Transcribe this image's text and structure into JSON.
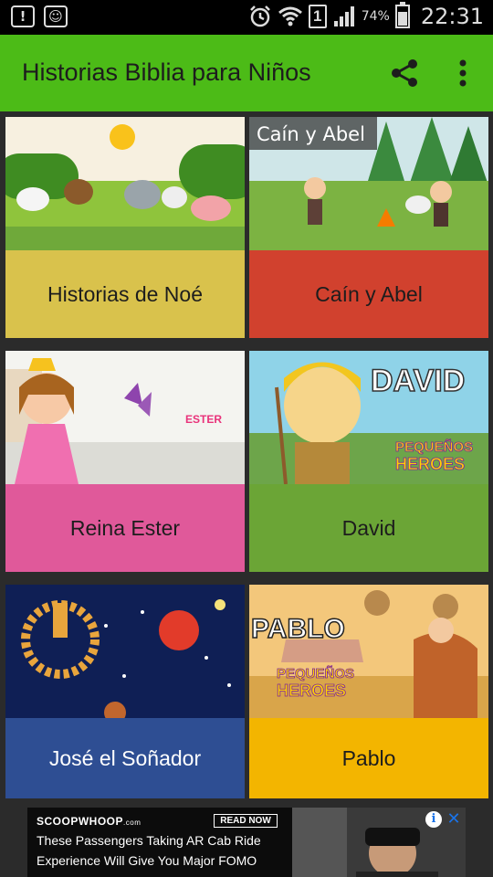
{
  "status_bar": {
    "battery_pct": "74%",
    "sim_label": "1",
    "time": "22:31",
    "icons": [
      "notification-alert-icon",
      "notification-face-icon",
      "alarm-icon",
      "wifi-icon",
      "sim-icon",
      "signal-icon",
      "battery-icon"
    ]
  },
  "app_bar": {
    "title": "Historias Biblia para Niños",
    "color": "#4cbb17",
    "actions": [
      "share-icon",
      "more-vert-icon"
    ]
  },
  "stories": [
    {
      "label": "Historias de Noé",
      "color": "#d9c24c",
      "thumb_caption": ""
    },
    {
      "label": "Caín y Abel",
      "color": "#d1412e",
      "thumb_caption": "Caín y Abel"
    },
    {
      "label": "Reina Ester",
      "color": "#e0599a",
      "thumb_caption": "ESTER"
    },
    {
      "label": "David",
      "color": "#6ba536",
      "thumb_caption": "DAVID",
      "thumb_caption2": "PEQUEÑOS",
      "thumb_caption3": "HEROES"
    },
    {
      "label": "José el Soñador",
      "color": "#2e4e93",
      "thumb_caption": ""
    },
    {
      "label": "Pablo",
      "color": "#f3b500",
      "thumb_caption": "PABLO",
      "thumb_caption2": "PEQUEÑOS",
      "thumb_caption3": "HEROES"
    }
  ],
  "ad": {
    "brand": "SCOOPWHOOP",
    "brand_suffix": ".com",
    "cta": "READ NOW",
    "line1": "These Passengers Taking AR Cab Ride",
    "line2": "Experience Will Give You Major FOMO",
    "info_glyph": "i",
    "close_glyph": "✕"
  }
}
